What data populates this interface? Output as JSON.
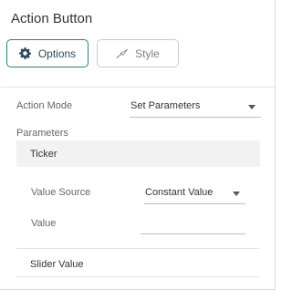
{
  "panel": {
    "title": "Action Button"
  },
  "tabs": [
    {
      "label": "Options",
      "icon": "gear-icon",
      "active": true
    },
    {
      "label": "Style",
      "icon": "brush-icon",
      "active": false
    }
  ],
  "action_mode": {
    "label": "Action Mode",
    "value": "Set Parameters"
  },
  "parameters": {
    "label": "Parameters",
    "items": [
      "Ticker",
      "Slider Value"
    ],
    "selected": "Ticker"
  },
  "detail": {
    "value_source": {
      "label": "Value Source",
      "value": "Constant Value"
    },
    "value": {
      "label": "Value",
      "value": ""
    }
  },
  "colors": {
    "accent": "#2e7d84",
    "selected_row_bg": "#f2f2f2"
  }
}
